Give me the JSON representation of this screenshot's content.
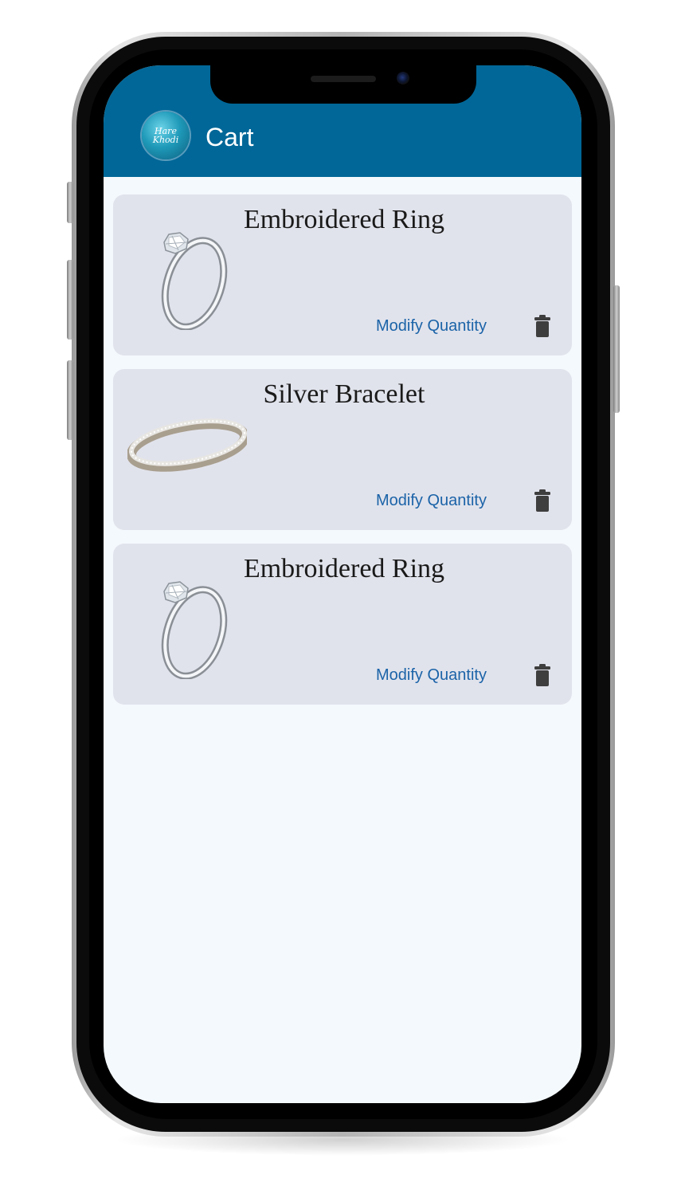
{
  "app": {
    "logo_text": "Hare Khodi",
    "header_title": "Cart"
  },
  "cart": {
    "items": [
      {
        "name": "Embroidered Ring",
        "image_icon": "ring-icon",
        "modify_label": "Modify Quantity",
        "delete_icon": "trash-icon"
      },
      {
        "name": "Silver Bracelet",
        "image_icon": "bracelet-icon",
        "modify_label": "Modify Quantity",
        "delete_icon": "trash-icon"
      },
      {
        "name": "Embroidered Ring",
        "image_icon": "ring-icon",
        "modify_label": "Modify Quantity",
        "delete_icon": "trash-icon"
      }
    ]
  },
  "colors": {
    "header": "#006798",
    "screen_background": "#f4f9fd",
    "card_background": "#e1e3ec",
    "link": "#1b63a8",
    "trash": "#3e3e3e"
  }
}
